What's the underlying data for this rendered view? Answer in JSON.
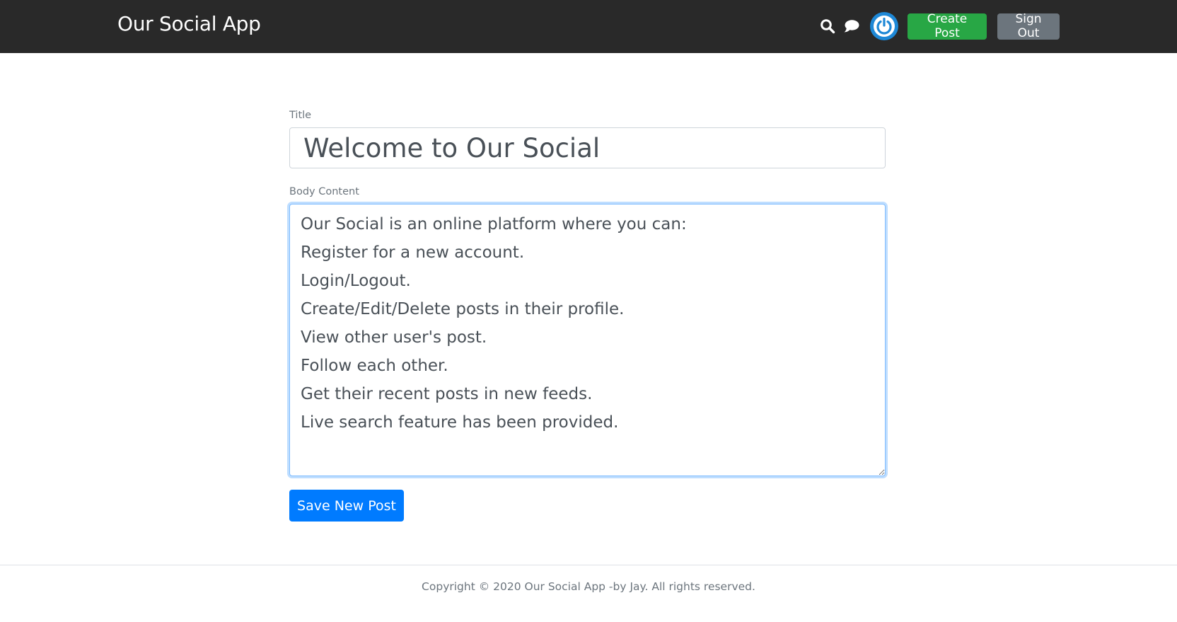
{
  "navbar": {
    "brand": "Our Social App",
    "search_icon": "search-icon",
    "chat_icon": "chat-icon",
    "avatar_icon": "power-icon",
    "create_post_label": "Create Post",
    "sign_out_label": "Sign Out"
  },
  "form": {
    "title_label": "Title",
    "title_value": "Welcome to Our Social",
    "body_label": "Body Content",
    "body_value": "Our Social is an online platform where you can:\nRegister for a new account.\nLogin/Logout.\nCreate/Edit/Delete posts in their profile.\nView other user's post.\nFollow each other.\nGet their recent posts in new feeds.\nLive search feature has been provided.",
    "save_label": "Save New Post"
  },
  "footer": {
    "copyright": "Copyright © 2020 Our Social App -by Jay. All rights reserved."
  },
  "colors": {
    "navbar_bg": "#292929",
    "success": "#28a745",
    "secondary": "#6c757d",
    "primary": "#007bff",
    "avatar": "#1e88d6"
  }
}
